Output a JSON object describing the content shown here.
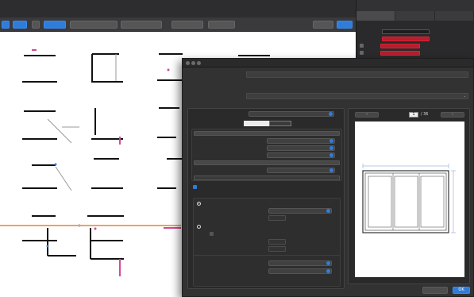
{
  "toolbar": {
    "scale_label": "",
    "zoom_label": ""
  },
  "inspector": {
    "top_right_label": "",
    "tabs": [
      {
        "label": ""
      },
      {
        "label": ""
      },
      {
        "label": ""
      }
    ],
    "section_title": "",
    "row_label_1": "",
    "row_label_2": "",
    "field_1": "",
    "field_2": "",
    "field_3": "",
    "field_4": "",
    "field_5": "",
    "field_6": ""
  },
  "dialog": {
    "title": "",
    "source_label": "",
    "source_value": "",
    "selection_label": "",
    "selection_value": "",
    "type_label": "",
    "type_value": "",
    "image_label": "",
    "image_value": "",
    "settings_heading": "",
    "display_mode_label": "",
    "display_mode_value": "",
    "tabs": [
      {
        "label": ""
      },
      {
        "label": ""
      }
    ],
    "class_button": "",
    "detail_level_label": "",
    "detail_level_value": "",
    "view_label": "",
    "view_value": "",
    "background_render_label": "",
    "background_render_value": "",
    "background_settings_button": "",
    "outline_render_label": "",
    "outline_render_value": "",
    "disabled_button": "",
    "doors_checkbox_label": "",
    "scale_group_label": "",
    "scale_radio_label": "",
    "scale_field_label": "",
    "scale_field_value": "",
    "custom_scale_label": "",
    "custom_scale_value": "",
    "fit_radio_label": "",
    "fit_checkbox_label": "",
    "width_label": "",
    "width_value": "",
    "height_label": "",
    "height_value": "",
    "alignment_heading": "",
    "vertical_align_label": "",
    "vertical_align_value": "",
    "horizontal_align_label": "",
    "horizontal_align_value": "",
    "preview_heading": "",
    "prev_button": "‹",
    "next_button": "›",
    "cell_label": "",
    "cell_value": "1",
    "cell_of": "/ 36",
    "dimension_top": "",
    "dimension_side": "",
    "cancel_button": "",
    "ok_button": "OK"
  },
  "colors": {
    "accent": "#2f7ddb",
    "dialog_bg": "#323232",
    "panel_bg": "#2a2a2a",
    "warning_red": "#b21f2d",
    "drawing_magenta": "#d04a9a",
    "drawing_orange": "#f0a15c"
  }
}
